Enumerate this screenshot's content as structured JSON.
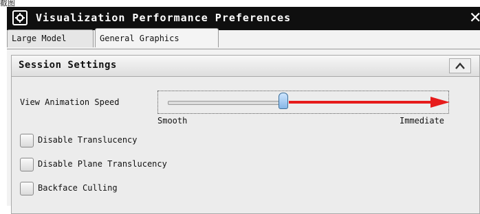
{
  "crop_label": "截图",
  "dialog": {
    "title": "Visualization Performance Preferences",
    "close_glyph": "✕"
  },
  "tabs": [
    {
      "label": "Large Model",
      "active": false
    },
    {
      "label": "General Graphics",
      "active": true
    }
  ],
  "session_settings": {
    "header": "Session Settings",
    "view_animation_speed": {
      "label": "View Animation Speed",
      "min_label": "Smooth",
      "max_label": "Immediate"
    },
    "checkboxes": [
      {
        "label": "Disable Translucency",
        "checked": false
      },
      {
        "label": "Disable Plane Translucency",
        "checked": false
      },
      {
        "label": "Backface Culling",
        "checked": false
      }
    ]
  },
  "colors": {
    "titlebar": "#0f0f0f",
    "annotation_arrow": "#e61b1b",
    "slider_thumb": "#86b6e6"
  }
}
